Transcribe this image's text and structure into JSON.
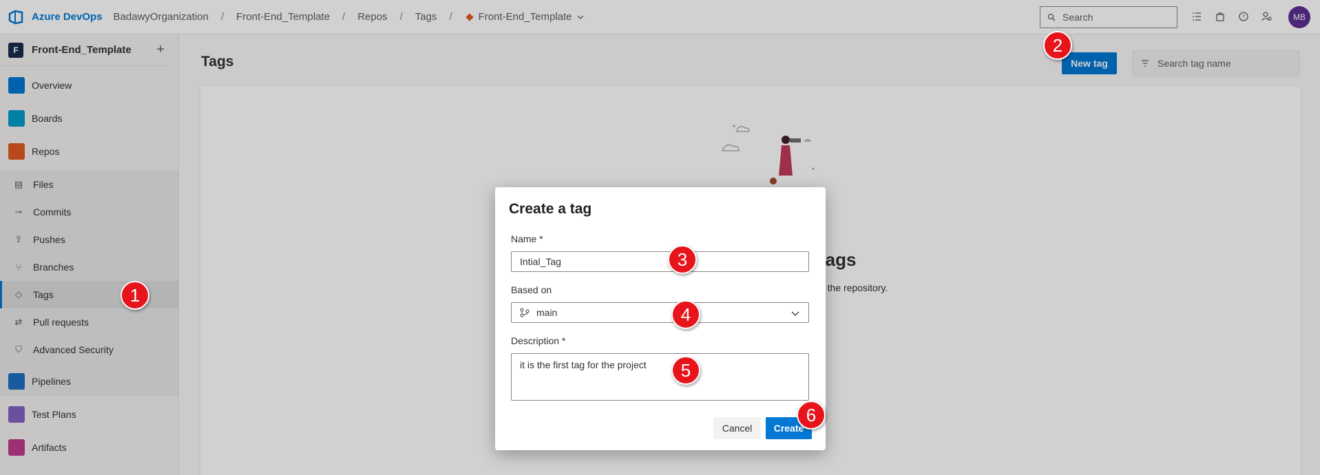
{
  "topbar": {
    "brand": "Azure DevOps",
    "breadcrumbs": [
      "BadawyOrganization",
      "Front-End_Template",
      "Repos",
      "Tags"
    ],
    "repo_selector": "Front-End_Template",
    "search_placeholder": "Search",
    "avatar_initials": "MB"
  },
  "sidebar": {
    "project_initial": "F",
    "project_name": "Front-End_Template",
    "add_label": "+",
    "items": [
      {
        "label": "Overview",
        "icon": "overview-icon",
        "color": "#0078d4"
      },
      {
        "label": "Boards",
        "icon": "boards-icon",
        "color": "#009ccc"
      },
      {
        "label": "Repos",
        "icon": "repos-icon",
        "color": "#e05a24"
      },
      {
        "label": "Files",
        "icon": "files-icon"
      },
      {
        "label": "Commits",
        "icon": "commits-icon"
      },
      {
        "label": "Pushes",
        "icon": "pushes-icon"
      },
      {
        "label": "Branches",
        "icon": "branches-icon"
      },
      {
        "label": "Tags",
        "icon": "tag-icon"
      },
      {
        "label": "Pull requests",
        "icon": "pull-request-icon"
      },
      {
        "label": "Advanced Security",
        "icon": "shield-icon"
      },
      {
        "label": "Pipelines",
        "icon": "pipelines-icon",
        "color": "#1f6fc5"
      },
      {
        "label": "Test Plans",
        "icon": "test-plans-icon",
        "color": "#8661c5"
      },
      {
        "label": "Artifacts",
        "icon": "artifacts-icon",
        "color": "#c03a8f"
      }
    ]
  },
  "main": {
    "title": "Tags",
    "new_tag_label": "New tag",
    "search_tag_placeholder": "Search tag name",
    "empty_title_fragment": "tags",
    "empty_sub_fragment": "o the repository."
  },
  "dialog": {
    "title": "Create a tag",
    "name_label": "Name *",
    "name_value": "Intial_Tag",
    "based_on_label": "Based on",
    "based_on_value": "main",
    "description_label": "Description *",
    "description_value": "it is the first tag for the project",
    "cancel_label": "Cancel",
    "create_label": "Create"
  },
  "markers": [
    "1",
    "2",
    "3",
    "4",
    "5",
    "6"
  ],
  "colors": {
    "accent": "#0078d4",
    "marker": "#e8141b"
  }
}
